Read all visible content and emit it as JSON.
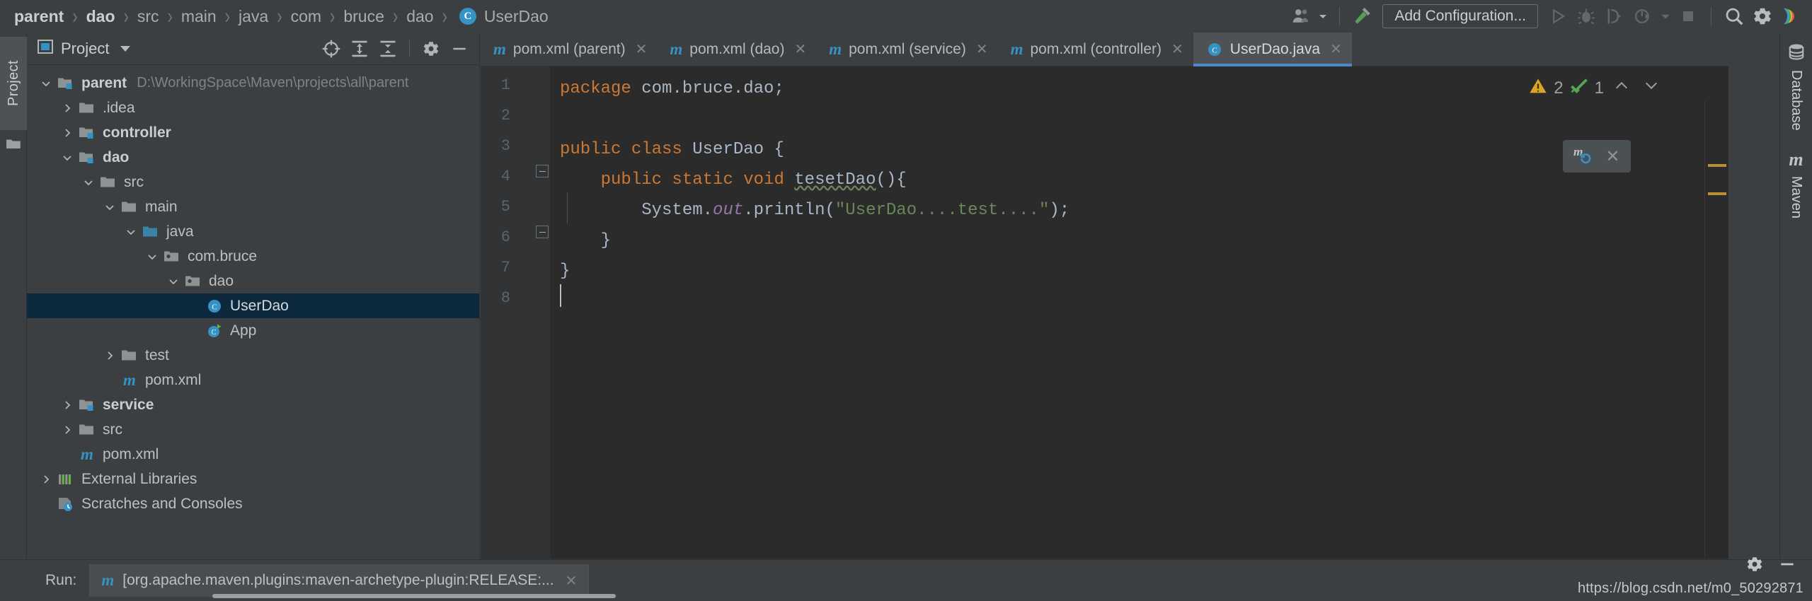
{
  "window": {
    "breadcrumb": [
      {
        "label": "parent",
        "bold": true
      },
      {
        "label": "dao",
        "bold": true
      },
      {
        "label": "src",
        "bold": false
      },
      {
        "label": "main",
        "bold": false
      },
      {
        "label": "java",
        "bold": false
      },
      {
        "label": "com",
        "bold": false
      },
      {
        "label": "bruce",
        "bold": false
      },
      {
        "label": "dao",
        "bold": false
      }
    ],
    "current_file": "UserDao",
    "separator": "›"
  },
  "toolbar": {
    "user_icon": "user-account-icon",
    "build_icon": "build-hammer-icon",
    "add_configuration": "Add Configuration...",
    "run_icon": "run-play-icon",
    "debug_icon": "debug-bug-icon",
    "run_with_coverage_icon": "run-coverage-icon",
    "profile_icon": "profiler-icon",
    "dropdown_icon": "chevron-down-icon",
    "stop_icon": "stop-square-icon",
    "search_icon": "search-magnifier-icon",
    "settings_icon": "settings-gear-icon",
    "ide_logo": "intellij-idea-logo"
  },
  "left_strip": {
    "project_tab": "Project",
    "folder_icon": "folder-icon"
  },
  "project_panel": {
    "title": "Project",
    "dropdown_icon": "chevron-down-icon",
    "tools": [
      {
        "name": "locate-target-icon"
      },
      {
        "name": "expand-all-icon"
      },
      {
        "name": "collapse-all-icon"
      },
      {
        "name": "settings-gear-icon"
      },
      {
        "name": "hide-minimize-icon"
      }
    ],
    "tree": [
      {
        "label": "parent",
        "path": "D:\\WorkingSpace\\Maven\\projects\\all\\parent",
        "depth": 0,
        "arrow": "down",
        "icon": "maven-module-folder-icon",
        "bold": true,
        "selected": false
      },
      {
        "label": ".idea",
        "path": "",
        "depth": 1,
        "arrow": "right",
        "icon": "folder-icon",
        "bold": false,
        "selected": false
      },
      {
        "label": "controller",
        "path": "",
        "depth": 1,
        "arrow": "right",
        "icon": "maven-module-folder-icon",
        "bold": true,
        "selected": false
      },
      {
        "label": "dao",
        "path": "",
        "depth": 1,
        "arrow": "down",
        "icon": "maven-module-folder-icon",
        "bold": true,
        "selected": false
      },
      {
        "label": "src",
        "path": "",
        "depth": 2,
        "arrow": "down",
        "icon": "folder-icon",
        "bold": false,
        "selected": false
      },
      {
        "label": "main",
        "path": "",
        "depth": 3,
        "arrow": "down",
        "icon": "folder-icon",
        "bold": false,
        "selected": false
      },
      {
        "label": "java",
        "path": "",
        "depth": 4,
        "arrow": "down",
        "icon": "source-root-folder-icon",
        "bold": false,
        "selected": false
      },
      {
        "label": "com.bruce",
        "path": "",
        "depth": 5,
        "arrow": "down",
        "icon": "package-icon",
        "bold": false,
        "selected": false
      },
      {
        "label": "dao",
        "path": "",
        "depth": 6,
        "arrow": "down",
        "icon": "package-icon",
        "bold": false,
        "selected": false
      },
      {
        "label": "UserDao",
        "path": "",
        "depth": 7,
        "arrow": "none",
        "icon": "java-class-icon",
        "bold": false,
        "selected": true
      },
      {
        "label": "App",
        "path": "",
        "depth": 7,
        "arrow": "none",
        "icon": "java-runnable-class-icon",
        "bold": false,
        "selected": false
      },
      {
        "label": "test",
        "path": "",
        "depth": 3,
        "arrow": "right",
        "icon": "folder-icon",
        "bold": false,
        "selected": false
      },
      {
        "label": "pom.xml",
        "path": "",
        "depth": 3,
        "arrow": "none",
        "icon": "maven-pom-icon",
        "bold": false,
        "selected": false
      },
      {
        "label": "service",
        "path": "",
        "depth": 1,
        "arrow": "right",
        "icon": "maven-module-folder-icon",
        "bold": true,
        "selected": false
      },
      {
        "label": "src",
        "path": "",
        "depth": 1,
        "arrow": "right",
        "icon": "folder-icon",
        "bold": false,
        "selected": false
      },
      {
        "label": "pom.xml",
        "path": "",
        "depth": 1,
        "arrow": "none",
        "icon": "maven-pom-icon",
        "bold": false,
        "selected": false
      },
      {
        "label": "External Libraries",
        "path": "",
        "depth": 0,
        "arrow": "right",
        "icon": "external-libraries-icon",
        "bold": false,
        "selected": false
      },
      {
        "label": "Scratches and Consoles",
        "path": "",
        "depth": 0,
        "arrow": "none",
        "icon": "scratches-icon",
        "bold": false,
        "selected": false
      }
    ]
  },
  "editor": {
    "tabs": [
      {
        "label": "pom.xml (parent)",
        "icon": "maven-pom-icon",
        "active": false,
        "closable": true
      },
      {
        "label": "pom.xml (dao)",
        "icon": "maven-pom-icon",
        "active": false,
        "closable": true
      },
      {
        "label": "pom.xml (service)",
        "icon": "maven-pom-icon",
        "active": false,
        "closable": true
      },
      {
        "label": "pom.xml (controller)",
        "icon": "maven-pom-icon",
        "active": false,
        "closable": true
      },
      {
        "label": "UserDao.java",
        "icon": "java-class-icon",
        "active": true,
        "closable": true
      }
    ],
    "line_numbers": [
      "1",
      "2",
      "3",
      "4",
      "5",
      "6",
      "7",
      "8"
    ],
    "code_lines": [
      {
        "n": 1,
        "tokens": [
          {
            "t": "package",
            "c": "kw"
          },
          {
            "t": " com.bruce.dao;",
            "c": "pl"
          }
        ]
      },
      {
        "n": 2,
        "tokens": []
      },
      {
        "n": 3,
        "tokens": [
          {
            "t": "public class ",
            "c": "kw"
          },
          {
            "t": "UserDao",
            "c": "cls"
          },
          {
            "t": " {",
            "c": "pl"
          }
        ]
      },
      {
        "n": 4,
        "tokens": [
          {
            "t": "    public static void ",
            "c": "kw"
          },
          {
            "t": "tesetDao",
            "c": "typo"
          },
          {
            "t": "(){",
            "c": "pl"
          }
        ]
      },
      {
        "n": 5,
        "tokens": [
          {
            "t": "        System.",
            "c": "pl"
          },
          {
            "t": "out",
            "c": "sfield"
          },
          {
            "t": ".println(",
            "c": "pl"
          },
          {
            "t": "\"UserDao....test....\"",
            "c": "str"
          },
          {
            "t": ");",
            "c": "pl"
          }
        ]
      },
      {
        "n": 6,
        "tokens": [
          {
            "t": "    }",
            "c": "pl"
          }
        ]
      },
      {
        "n": 7,
        "tokens": [
          {
            "t": "}",
            "c": "pl"
          }
        ]
      },
      {
        "n": 8,
        "tokens": []
      }
    ],
    "inspection": {
      "warning_icon": "warning-triangle-icon",
      "warning_count": "2",
      "ok_icon": "inspection-ok-checkmark-icon",
      "ok_count": "1",
      "prev_icon": "chevron-up-icon",
      "next_icon": "chevron-down-icon"
    },
    "maven_popup": {
      "reload_icon": "maven-reload-icon",
      "close_icon": "close-x-icon"
    },
    "stripe_marks": 2
  },
  "right_strip": {
    "tabs": [
      {
        "label": "Database",
        "icon": "database-icon"
      },
      {
        "label": "Maven",
        "icon": "maven-m-icon"
      }
    ]
  },
  "bottom": {
    "run_label": "Run:",
    "run_tab_icon": "maven-pom-icon",
    "run_tab_text": "[org.apache.maven.plugins:maven-archetype-plugin:RELEASE:...",
    "run_tab_close": "close-x-icon",
    "settings_icon": "settings-gear-icon",
    "minimize_icon": "hide-minimize-icon",
    "watermark": "https://blog.csdn.net/m0_50292871"
  },
  "colors": {
    "chrome_bg": "#3c3f41",
    "editor_bg": "#2b2b2b",
    "gutter_bg": "#313335",
    "accent_blue": "#3592c4",
    "tab_underline": "#4a88c7",
    "selection_bg": "#0d293e",
    "keyword_orange": "#cc7832",
    "string_green": "#6a8759",
    "static_field_purple": "#9876aa",
    "plain_text": "#a9b7c6",
    "warning_yellow": "#bb9033"
  }
}
